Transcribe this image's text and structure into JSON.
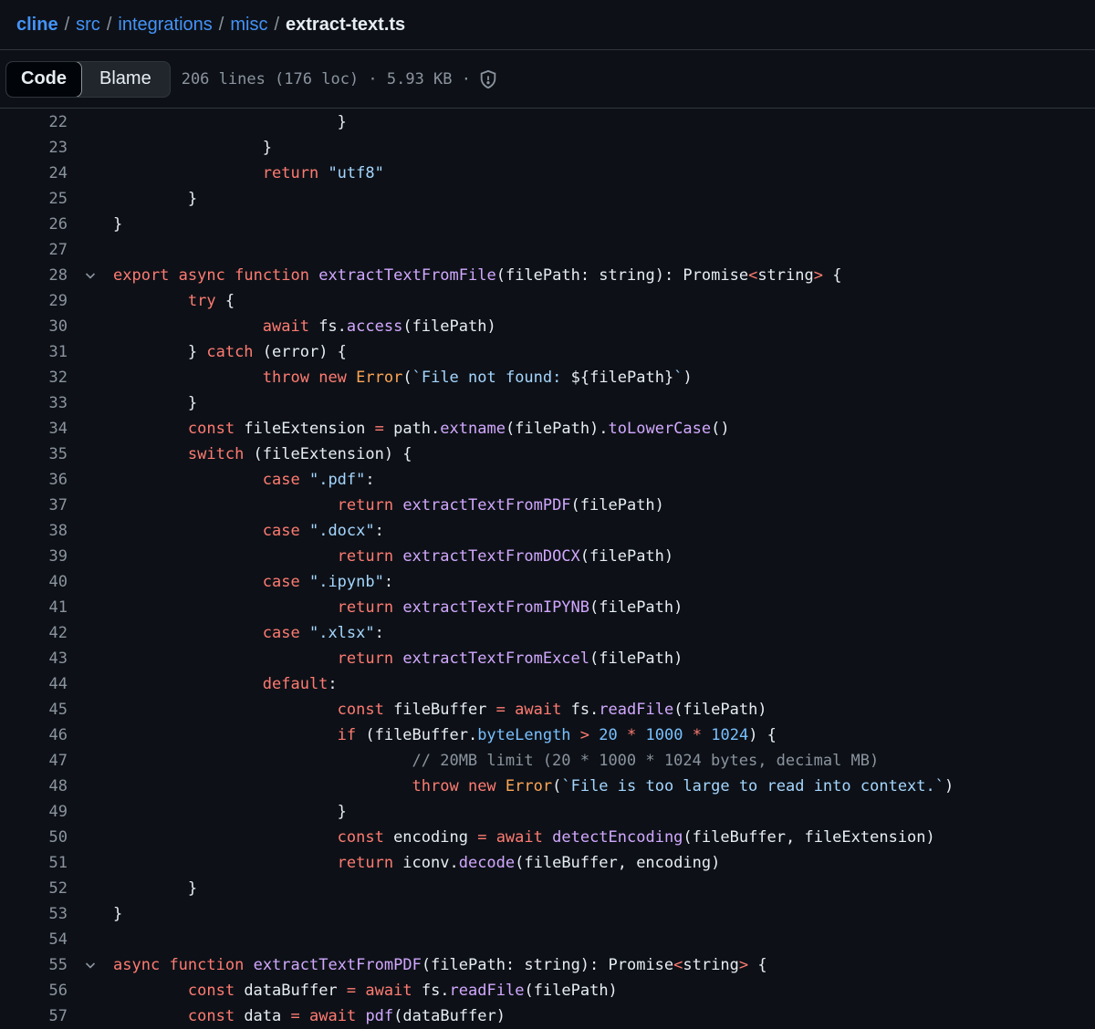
{
  "breadcrumb": {
    "repo": "cline",
    "path": [
      "src",
      "integrations",
      "misc"
    ],
    "file": "extract-text.ts",
    "separator": "/"
  },
  "toolbar": {
    "code_label": "Code",
    "blame_label": "Blame",
    "file_info": "206 lines (176 loc) · 5.93 KB ·",
    "security_icon": "shield-icon"
  },
  "colors": {
    "background": "#0d1117",
    "link": "#4493f8",
    "keyword": "#ff7b72",
    "function": "#d2a8ff",
    "string": "#a5d6ff",
    "comment": "#8b949e",
    "class": "#ffa657",
    "constant": "#79c0ff"
  },
  "code": {
    "lines": [
      {
        "n": "22",
        "fold": false,
        "tokens": [
          [
            "p",
            "\t\t\t}"
          ]
        ]
      },
      {
        "n": "23",
        "fold": false,
        "tokens": [
          [
            "p",
            "\t\t}"
          ]
        ]
      },
      {
        "n": "24",
        "fold": false,
        "tokens": [
          [
            "p",
            "\t\t"
          ],
          [
            "k",
            "return"
          ],
          [
            "p",
            " "
          ],
          [
            "s",
            "\"utf8\""
          ]
        ]
      },
      {
        "n": "25",
        "fold": false,
        "tokens": [
          [
            "p",
            "\t}"
          ]
        ]
      },
      {
        "n": "26",
        "fold": false,
        "tokens": [
          [
            "p",
            "}"
          ]
        ]
      },
      {
        "n": "27",
        "fold": false,
        "tokens": []
      },
      {
        "n": "28",
        "fold": true,
        "tokens": [
          [
            "k",
            "export"
          ],
          [
            "p",
            " "
          ],
          [
            "k",
            "async"
          ],
          [
            "p",
            " "
          ],
          [
            "k",
            "function"
          ],
          [
            "p",
            " "
          ],
          [
            "f",
            "extractTextFromFile"
          ],
          [
            "p",
            "(filePath: string): Promise"
          ],
          [
            "k",
            "<"
          ],
          [
            "p",
            "string"
          ],
          [
            "k",
            ">"
          ],
          [
            "p",
            " {"
          ]
        ]
      },
      {
        "n": "29",
        "fold": false,
        "tokens": [
          [
            "p",
            "\t"
          ],
          [
            "k",
            "try"
          ],
          [
            "p",
            " {"
          ]
        ]
      },
      {
        "n": "30",
        "fold": false,
        "tokens": [
          [
            "p",
            "\t\t"
          ],
          [
            "k",
            "await"
          ],
          [
            "p",
            " fs."
          ],
          [
            "f",
            "access"
          ],
          [
            "p",
            "(filePath)"
          ]
        ]
      },
      {
        "n": "31",
        "fold": false,
        "tokens": [
          [
            "p",
            "\t} "
          ],
          [
            "k",
            "catch"
          ],
          [
            "p",
            " (error) {"
          ]
        ]
      },
      {
        "n": "32",
        "fold": false,
        "tokens": [
          [
            "p",
            "\t\t"
          ],
          [
            "k",
            "throw"
          ],
          [
            "p",
            " "
          ],
          [
            "k",
            "new"
          ],
          [
            "p",
            " "
          ],
          [
            "o",
            "Error"
          ],
          [
            "p",
            "("
          ],
          [
            "s",
            "`File not found: "
          ],
          [
            "p",
            "${filePath}"
          ],
          [
            "s",
            "`"
          ],
          [
            "p",
            ")"
          ]
        ]
      },
      {
        "n": "33",
        "fold": false,
        "tokens": [
          [
            "p",
            "\t}"
          ]
        ]
      },
      {
        "n": "34",
        "fold": false,
        "tokens": [
          [
            "p",
            "\t"
          ],
          [
            "k",
            "const"
          ],
          [
            "p",
            " fileExtension "
          ],
          [
            "k",
            "="
          ],
          [
            "p",
            " path."
          ],
          [
            "f",
            "extname"
          ],
          [
            "p",
            "(filePath)."
          ],
          [
            "f",
            "toLowerCase"
          ],
          [
            "p",
            "()"
          ]
        ]
      },
      {
        "n": "35",
        "fold": false,
        "tokens": [
          [
            "p",
            "\t"
          ],
          [
            "k",
            "switch"
          ],
          [
            "p",
            " (fileExtension) {"
          ]
        ]
      },
      {
        "n": "36",
        "fold": false,
        "tokens": [
          [
            "p",
            "\t\t"
          ],
          [
            "k",
            "case"
          ],
          [
            "p",
            " "
          ],
          [
            "s",
            "\".pdf\""
          ],
          [
            "p",
            ":"
          ]
        ]
      },
      {
        "n": "37",
        "fold": false,
        "tokens": [
          [
            "p",
            "\t\t\t"
          ],
          [
            "k",
            "return"
          ],
          [
            "p",
            " "
          ],
          [
            "f",
            "extractTextFromPDF"
          ],
          [
            "p",
            "(filePath)"
          ]
        ]
      },
      {
        "n": "38",
        "fold": false,
        "tokens": [
          [
            "p",
            "\t\t"
          ],
          [
            "k",
            "case"
          ],
          [
            "p",
            " "
          ],
          [
            "s",
            "\".docx\""
          ],
          [
            "p",
            ":"
          ]
        ]
      },
      {
        "n": "39",
        "fold": false,
        "tokens": [
          [
            "p",
            "\t\t\t"
          ],
          [
            "k",
            "return"
          ],
          [
            "p",
            " "
          ],
          [
            "f",
            "extractTextFromDOCX"
          ],
          [
            "p",
            "(filePath)"
          ]
        ]
      },
      {
        "n": "40",
        "fold": false,
        "tokens": [
          [
            "p",
            "\t\t"
          ],
          [
            "k",
            "case"
          ],
          [
            "p",
            " "
          ],
          [
            "s",
            "\".ipynb\""
          ],
          [
            "p",
            ":"
          ]
        ]
      },
      {
        "n": "41",
        "fold": false,
        "tokens": [
          [
            "p",
            "\t\t\t"
          ],
          [
            "k",
            "return"
          ],
          [
            "p",
            " "
          ],
          [
            "f",
            "extractTextFromIPYNB"
          ],
          [
            "p",
            "(filePath)"
          ]
        ]
      },
      {
        "n": "42",
        "fold": false,
        "tokens": [
          [
            "p",
            "\t\t"
          ],
          [
            "k",
            "case"
          ],
          [
            "p",
            " "
          ],
          [
            "s",
            "\".xlsx\""
          ],
          [
            "p",
            ":"
          ]
        ]
      },
      {
        "n": "43",
        "fold": false,
        "tokens": [
          [
            "p",
            "\t\t\t"
          ],
          [
            "k",
            "return"
          ],
          [
            "p",
            " "
          ],
          [
            "f",
            "extractTextFromExcel"
          ],
          [
            "p",
            "(filePath)"
          ]
        ]
      },
      {
        "n": "44",
        "fold": false,
        "tokens": [
          [
            "p",
            "\t\t"
          ],
          [
            "k",
            "default"
          ],
          [
            "p",
            ":"
          ]
        ]
      },
      {
        "n": "45",
        "fold": false,
        "tokens": [
          [
            "p",
            "\t\t\t"
          ],
          [
            "k",
            "const"
          ],
          [
            "p",
            " fileBuffer "
          ],
          [
            "k",
            "="
          ],
          [
            "p",
            " "
          ],
          [
            "k",
            "await"
          ],
          [
            "p",
            " fs."
          ],
          [
            "f",
            "readFile"
          ],
          [
            "p",
            "(filePath)"
          ]
        ]
      },
      {
        "n": "46",
        "fold": false,
        "tokens": [
          [
            "p",
            "\t\t\t"
          ],
          [
            "k",
            "if"
          ],
          [
            "p",
            " (fileBuffer."
          ],
          [
            "n",
            "byteLength"
          ],
          [
            "p",
            " "
          ],
          [
            "k",
            ">"
          ],
          [
            "p",
            " "
          ],
          [
            "n",
            "20"
          ],
          [
            "p",
            " "
          ],
          [
            "k",
            "*"
          ],
          [
            "p",
            " "
          ],
          [
            "n",
            "1000"
          ],
          [
            "p",
            " "
          ],
          [
            "k",
            "*"
          ],
          [
            "p",
            " "
          ],
          [
            "n",
            "1024"
          ],
          [
            "p",
            ") {"
          ]
        ]
      },
      {
        "n": "47",
        "fold": false,
        "tokens": [
          [
            "p",
            "\t\t\t\t"
          ],
          [
            "c",
            "// 20MB limit (20 * 1000 * 1024 bytes, decimal MB)"
          ]
        ]
      },
      {
        "n": "48",
        "fold": false,
        "tokens": [
          [
            "p",
            "\t\t\t\t"
          ],
          [
            "k",
            "throw"
          ],
          [
            "p",
            " "
          ],
          [
            "k",
            "new"
          ],
          [
            "p",
            " "
          ],
          [
            "o",
            "Error"
          ],
          [
            "p",
            "("
          ],
          [
            "s",
            "`File is too large to read into context.`"
          ],
          [
            "p",
            ")"
          ]
        ]
      },
      {
        "n": "49",
        "fold": false,
        "tokens": [
          [
            "p",
            "\t\t\t}"
          ]
        ]
      },
      {
        "n": "50",
        "fold": false,
        "tokens": [
          [
            "p",
            "\t\t\t"
          ],
          [
            "k",
            "const"
          ],
          [
            "p",
            " encoding "
          ],
          [
            "k",
            "="
          ],
          [
            "p",
            " "
          ],
          [
            "k",
            "await"
          ],
          [
            "p",
            " "
          ],
          [
            "f",
            "detectEncoding"
          ],
          [
            "p",
            "(fileBuffer, fileExtension)"
          ]
        ]
      },
      {
        "n": "51",
        "fold": false,
        "tokens": [
          [
            "p",
            "\t\t\t"
          ],
          [
            "k",
            "return"
          ],
          [
            "p",
            " iconv."
          ],
          [
            "f",
            "decode"
          ],
          [
            "p",
            "(fileBuffer, encoding)"
          ]
        ]
      },
      {
        "n": "52",
        "fold": false,
        "tokens": [
          [
            "p",
            "\t}"
          ]
        ]
      },
      {
        "n": "53",
        "fold": false,
        "tokens": [
          [
            "p",
            "}"
          ]
        ]
      },
      {
        "n": "54",
        "fold": false,
        "tokens": []
      },
      {
        "n": "55",
        "fold": true,
        "tokens": [
          [
            "k",
            "async"
          ],
          [
            "p",
            " "
          ],
          [
            "k",
            "function"
          ],
          [
            "p",
            " "
          ],
          [
            "f",
            "extractTextFromPDF"
          ],
          [
            "p",
            "(filePath: string): Promise"
          ],
          [
            "k",
            "<"
          ],
          [
            "p",
            "string"
          ],
          [
            "k",
            ">"
          ],
          [
            "p",
            " {"
          ]
        ]
      },
      {
        "n": "56",
        "fold": false,
        "tokens": [
          [
            "p",
            "\t"
          ],
          [
            "k",
            "const"
          ],
          [
            "p",
            " dataBuffer "
          ],
          [
            "k",
            "="
          ],
          [
            "p",
            " "
          ],
          [
            "k",
            "await"
          ],
          [
            "p",
            " fs."
          ],
          [
            "f",
            "readFile"
          ],
          [
            "p",
            "(filePath)"
          ]
        ]
      },
      {
        "n": "57",
        "fold": false,
        "tokens": [
          [
            "p",
            "\t"
          ],
          [
            "k",
            "const"
          ],
          [
            "p",
            " data "
          ],
          [
            "k",
            "="
          ],
          [
            "p",
            " "
          ],
          [
            "k",
            "await"
          ],
          [
            "p",
            " "
          ],
          [
            "f",
            "pdf"
          ],
          [
            "p",
            "(dataBuffer)"
          ]
        ]
      }
    ]
  }
}
